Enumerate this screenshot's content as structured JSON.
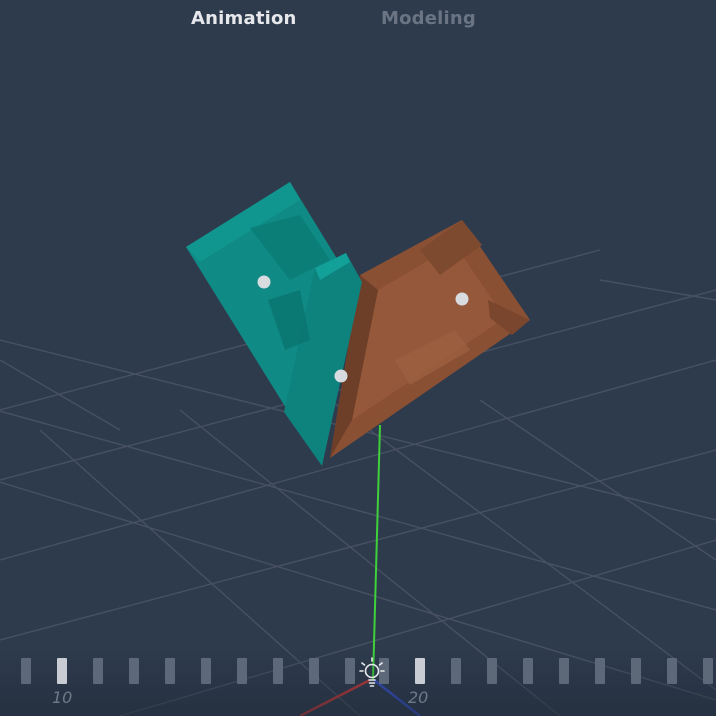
{
  "tabs": [
    {
      "label": "Animation",
      "active": true
    },
    {
      "label": "Modeling",
      "active": false
    }
  ],
  "timeline": {
    "labels": [
      "10",
      "20"
    ]
  },
  "colors": {
    "background": "#2e3b4d",
    "grid": "#4a5463",
    "teal_part": "#0f8a84",
    "brown_part": "#8a5034",
    "y_axis": "#3ed13a",
    "x_axis": "#c43838",
    "z_axis": "#3450c8",
    "pivot": "#d8dbe0"
  },
  "icons": {
    "light": "lightbulb-icon"
  }
}
